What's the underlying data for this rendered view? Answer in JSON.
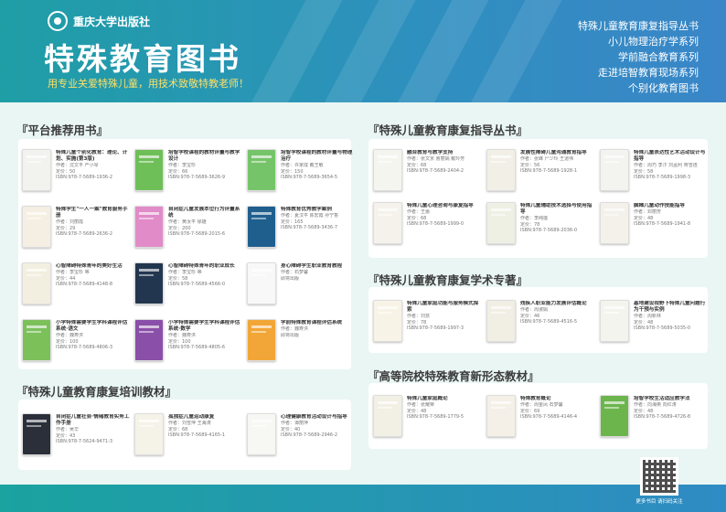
{
  "header": {
    "publisher": "重庆大学出版社",
    "title": "特殊教育图书",
    "slogan": "用专业关爱特殊儿童，用技术致敬特教老师！",
    "series": [
      "特殊儿童教育康复指导丛书",
      "小儿物理治疗学系列",
      "学前融合教育系列",
      "走进培智教育现场系列",
      "个别化教育图书"
    ]
  },
  "sections": [
    {
      "title": "『平台推荐用书』",
      "books": [
        {
          "title": "特殊儿童个别化教育：理论、计划、实施(第3版)",
          "lines": [
            "作者：沈文平 严小琴",
            "定价：50",
            "ISBN:978-7-5689-1936-2"
          ],
          "color": "#f2f2ee"
        },
        {
          "title": "培智学校课程的教材评量与教学设计",
          "lines": [
            "作者：李宝珍",
            "定价：66",
            "ISBN:978-7-5689-3626-9"
          ],
          "color": "#6fbf58"
        },
        {
          "title": "培智学校课程的教材评量与物理治疗",
          "lines": [
            "作者：许家成 戴王敏",
            "定价：150",
            "ISBN:978-7-5689-3654-5"
          ],
          "color": "#76c46a"
        },
        {
          "title": "特殊学生\"一人一案\"教育服务手册",
          "lines": [
            "作者：刘丽霞",
            "定价：29",
            "ISBN:978-7-5689-2636-2"
          ],
          "color": "#f4efe2"
        },
        {
          "title": "自闭症儿童发展本位行为评量系统",
          "lines": [
            "作者：黄汝平 徐雄",
            "定价：200",
            "ISBN:978-7-5689-2015-6"
          ],
          "color": "#e18bc8"
        },
        {
          "title": "特殊教育优秀教学案例",
          "lines": [
            "作者：夏汉平 陈宏霞 孙宁香",
            "定价：165",
            "ISBN:978-7-5689-3436-7"
          ],
          "color": "#1f5f8e"
        },
        {
          "title": "心智障碍特殊青年的美好生活",
          "lines": [
            "作者：李宝珍 等",
            "定价：44",
            "ISBN:978-7-5689-4148-8"
          ],
          "color": "#f3efe0"
        },
        {
          "title": "心智障碍特殊青年的职业成长",
          "lines": [
            "作者：李宝珍 等",
            "定价：58",
            "ISBN:978-7-5689-4566-0"
          ],
          "color": "#23364f"
        },
        {
          "title": "身心障碍学生职业教育教程",
          "lines": [
            "作者：石梦馨",
            "即将出版"
          ],
          "color": "#f8f8f8"
        },
        {
          "title": "小学特殊需要学生学科课程评估系统·语文",
          "lines": [
            "作者：魏寿洪",
            "定价：100",
            "ISBN:978-7-5689-4806-3"
          ],
          "color": "#7cc05a"
        },
        {
          "title": "小学特殊需要学生学科课程评估系统·数学",
          "lines": [
            "作者：魏寿洪",
            "定价：100",
            "ISBN:978-7-5689-4805-6"
          ],
          "color": "#8a4fa8"
        },
        {
          "title": "学前特殊教育课程评估系统",
          "lines": [
            "作者：魏寿洪",
            "即将出版"
          ],
          "color": "#f2a637"
        }
      ]
    },
    {
      "title": "『特殊儿童教育康复培训教材』",
      "books": [
        {
          "title": "自闭症儿童社会·情绪教育实务工作手册",
          "lines": [
            "作者：吴华",
            "定价：43",
            "ISBN:978-7-5624-9471-3"
          ],
          "color": "#2b2f3a"
        },
        {
          "title": "孤独症儿童运动康复",
          "lines": [
            "作者：刘雪萍 王海涛",
            "定价：68",
            "ISBN:978-7-5689-4165-1"
          ],
          "color": "#f5f2e8"
        },
        {
          "title": "心理健康教育活动设计与指导",
          "lines": [
            "作者：谭丽萍",
            "定价：40",
            "ISBN:978-7-5689-2946-2"
          ],
          "color": "#f7f7f3"
        }
      ]
    },
    {
      "title": "『特殊儿童教育康复指导丛书』",
      "books": [
        {
          "title": "融合教育与教学支持",
          "lines": [
            "作者：张文京 曹丽娟 戴玲芳",
            "定价：68",
            "ISBN:978-7-5689-2404-2"
          ],
          "color": "#f5f5f0"
        },
        {
          "title": "发展性障碍儿童沟通教育指导",
          "lines": [
            "作者：张峰 尸少玲 王道伟",
            "定价：56",
            "ISBN:978-7-5689-1928-1"
          ],
          "color": "#f2f0e6"
        },
        {
          "title": "特殊儿童表达性艺术活动设计与指导",
          "lines": [
            "作者：周巧 李汴 刘孟利 蒋雪连",
            "定价：58",
            "ISBN:978-7-5689-1998-3"
          ],
          "color": "#f3f3ef"
        },
        {
          "title": "特殊儿童心理咨询与康复指导",
          "lines": [
            "作者：王蕾",
            "定价：68",
            "ISBN:978-7-5689-1999-0"
          ],
          "color": "#f4f2ea"
        },
        {
          "title": "特殊儿童辅助技术选择与使用指导",
          "lines": [
            "作者：李纯莲",
            "定价：78",
            "ISBN:978-7-5689-2036-0"
          ],
          "color": "#eef0e4"
        },
        {
          "title": "脑瘫儿童动作技能指导",
          "lines": [
            "作者：邓丽芳",
            "定价：48",
            "ISBN:978-7-5689-1941-8"
          ],
          "color": "#f3f1ea"
        }
      ]
    },
    {
      "title": "『特殊儿童教育康复学术专著』",
      "books": [
        {
          "title": "特殊儿童家庭功能与服务模式探索",
          "lines": [
            "作者：刘慧",
            "定价：78",
            "ISBN:978-7-5689-1997-3"
          ],
          "color": "#f7f3e6"
        },
        {
          "title": "残疾人职业能力发展评估概论",
          "lines": [
            "作者：周淑娟",
            "定价：46",
            "ISBN:978-7-5689-4516-5"
          ],
          "color": "#f1eee4"
        },
        {
          "title": "基地建设视野下特殊儿童问题行为干预与实例",
          "lines": [
            "作者：周新林",
            "定价：48",
            "ISBN:978-7-5689-5035-0"
          ],
          "color": "#f4f4ef"
        }
      ]
    },
    {
      "title": "『高等院校特殊教育新形态教材』",
      "books": [
        {
          "title": "特殊儿童家庭概论",
          "lines": [
            "作者：张耀荣",
            "定价：48",
            "ISBN:978-7-5689-1779-5"
          ],
          "color": "#f2efe5"
        },
        {
          "title": "特殊教育概论",
          "lines": [
            "作者：周金凤 石梦馨",
            "定价：69",
            "ISBN:978-7-5689-4146-4"
          ],
          "color": "#f4f0e8"
        },
        {
          "title": "培智学校生活适应教学法",
          "lines": [
            "作者：向海英 向红涛",
            "定价：48",
            "ISBN:978-7-5689-4726-8"
          ],
          "color": "#6cb54d"
        }
      ]
    }
  ],
  "footer": {
    "qr_label": "更多书目 请扫码关注"
  }
}
